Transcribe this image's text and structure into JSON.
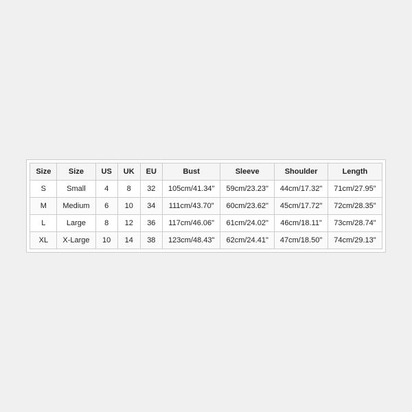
{
  "table": {
    "headers": [
      "Size",
      "Size",
      "US",
      "UK",
      "EU",
      "Bust",
      "Sleeve",
      "Shoulder",
      "Length"
    ],
    "rows": [
      {
        "size_code": "S",
        "size_name": "Small",
        "us": "4",
        "uk": "8",
        "eu": "32",
        "bust": "105cm/41.34\"",
        "sleeve": "59cm/23.23\"",
        "shoulder": "44cm/17.32\"",
        "length": "71cm/27.95\""
      },
      {
        "size_code": "M",
        "size_name": "Medium",
        "us": "6",
        "uk": "10",
        "eu": "34",
        "bust": "111cm/43.70\"",
        "sleeve": "60cm/23.62\"",
        "shoulder": "45cm/17.72\"",
        "length": "72cm/28.35\""
      },
      {
        "size_code": "L",
        "size_name": "Large",
        "us": "8",
        "uk": "12",
        "eu": "36",
        "bust": "117cm/46.06\"",
        "sleeve": "61cm/24.02\"",
        "shoulder": "46cm/18.11\"",
        "length": "73cm/28.74\""
      },
      {
        "size_code": "XL",
        "size_name": "X-Large",
        "us": "10",
        "uk": "14",
        "eu": "38",
        "bust": "123cm/48.43\"",
        "sleeve": "62cm/24.41\"",
        "shoulder": "47cm/18.50\"",
        "length": "74cm/29.13\""
      }
    ]
  }
}
